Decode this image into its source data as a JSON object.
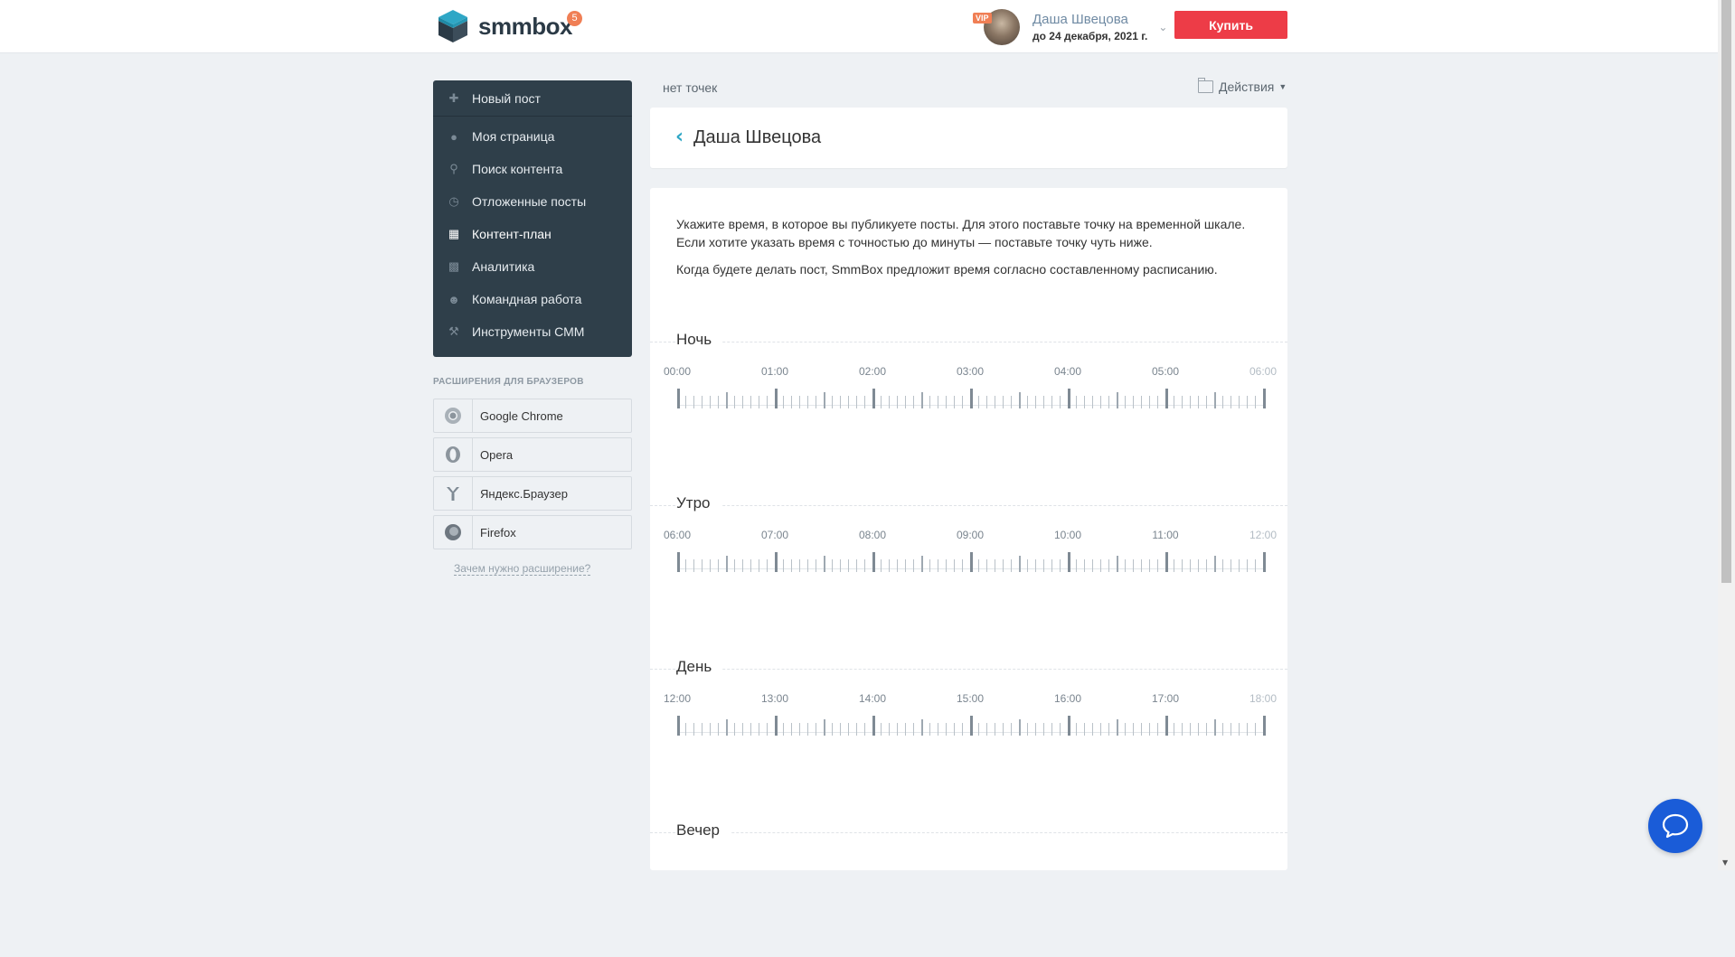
{
  "header": {
    "logo_text": "smmbox",
    "notification_count": "5",
    "vip_label": "VIP",
    "user_name": "Даша Швецова",
    "subscription_until": "до 24 декабря, 2021 г.",
    "buy_label": "Купить"
  },
  "sidebar": {
    "menu": [
      {
        "label": "Новый пост",
        "icon": "plus-icon"
      },
      {
        "label": "Моя страница",
        "icon": "user-icon"
      },
      {
        "label": "Поиск контента",
        "icon": "search-icon"
      },
      {
        "label": "Отложенные посты",
        "icon": "clock-icon"
      },
      {
        "label": "Контент-план",
        "icon": "calendar-icon",
        "active": true
      },
      {
        "label": "Аналитика",
        "icon": "bar-chart-icon"
      },
      {
        "label": "Командная работа",
        "icon": "team-icon"
      },
      {
        "label": "Инструменты СММ",
        "icon": "wrench-icon"
      }
    ],
    "extensions_title": "РАСШИРЕНИЯ ДЛЯ БРАУЗЕРОВ",
    "extensions": [
      {
        "label": "Google Chrome",
        "icon": "chrome-icon"
      },
      {
        "label": "Opera",
        "icon": "opera-icon"
      },
      {
        "label": "Яндекс.Браузер",
        "icon": "yandex-browser-icon"
      },
      {
        "label": "Firefox",
        "icon": "firefox-icon"
      }
    ],
    "why_link": "Зачем нужно расширение?"
  },
  "main": {
    "points_label": "нет точек",
    "actions_label": "Действия",
    "page_title": "Даша Швецова",
    "intro_1": "Укажите время, в которое вы публикуете посты. Для этого поставьте точку на временной шкале. Если хотите указать время с точностью до минуты — поставьте точку чуть ниже.",
    "intro_2": "Когда будете делать пост, SmmBox предложит время согласно составленному расписанию.",
    "sections": [
      {
        "title": "Ночь",
        "hours": [
          "00:00",
          "01:00",
          "02:00",
          "03:00",
          "04:00",
          "05:00",
          "06:00"
        ]
      },
      {
        "title": "Утро",
        "hours": [
          "06:00",
          "07:00",
          "08:00",
          "09:00",
          "10:00",
          "11:00",
          "12:00"
        ]
      },
      {
        "title": "День",
        "hours": [
          "12:00",
          "13:00",
          "14:00",
          "15:00",
          "16:00",
          "17:00",
          "18:00"
        ]
      },
      {
        "title": "Вечер",
        "hours": []
      }
    ]
  },
  "colors": {
    "sidebar_bg": "#2f3f4a",
    "buy_button": "#ed3c47",
    "accent": "#2fa7c6",
    "chat_button": "#1a5cd8",
    "page_bg": "#eef1f4"
  }
}
